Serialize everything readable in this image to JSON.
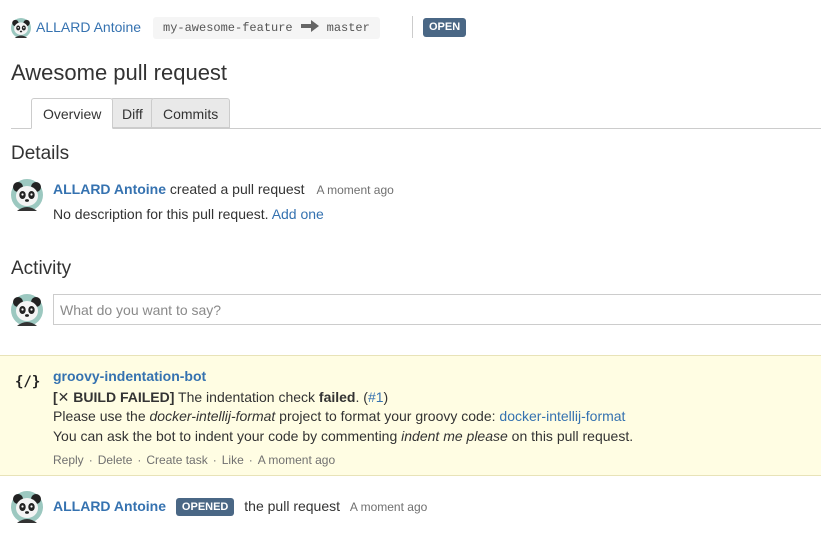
{
  "header": {
    "author": "ALLARD Antoine",
    "source_branch": "my-awesome-feature",
    "target_branch": "master",
    "state": "OPEN"
  },
  "pr": {
    "title": "Awesome pull request"
  },
  "tabs": [
    {
      "label": "Overview",
      "active": true
    },
    {
      "label": "Diff",
      "active": false
    },
    {
      "label": "Commits",
      "active": false
    }
  ],
  "details": {
    "heading": "Details",
    "author": "ALLARD Antoine",
    "action": "created a pull request",
    "time": "A moment ago",
    "description": "No description for this pull request.",
    "add_link": "Add one"
  },
  "activity": {
    "heading": "Activity",
    "comment_placeholder": "What do you want to say?",
    "bot_comment": {
      "icon": "{/}",
      "author": "groovy-indentation-bot",
      "line1_prefix": "[",
      "line1_mark": "✕",
      "line1_status": " BUILD FAILED]",
      "line1_text": " The indentation check ",
      "line1_failed": "failed",
      "line1_tail": ". (",
      "line1_link": "#1",
      "line1_close": ")",
      "line2_a": "Please use the ",
      "line2_project": "docker-intellij-format",
      "line2_b": " project to format your groovy code: ",
      "line2_link": "docker-intellij-format",
      "line3_a": "You can ask the bot to indent your code by commenting ",
      "line3_cmd": "indent me please",
      "line3_b": " on this pull request.",
      "actions": [
        "Reply",
        "Delete",
        "Create task",
        "Like"
      ],
      "time": "A moment ago"
    },
    "opened_event": {
      "author": "ALLARD Antoine",
      "badge": "OPENED",
      "text": "the pull request",
      "time": "A moment ago"
    }
  },
  "colors": {
    "link": "#3572b0",
    "badge": "#4a6785",
    "bot_bg": "#fffde3"
  }
}
